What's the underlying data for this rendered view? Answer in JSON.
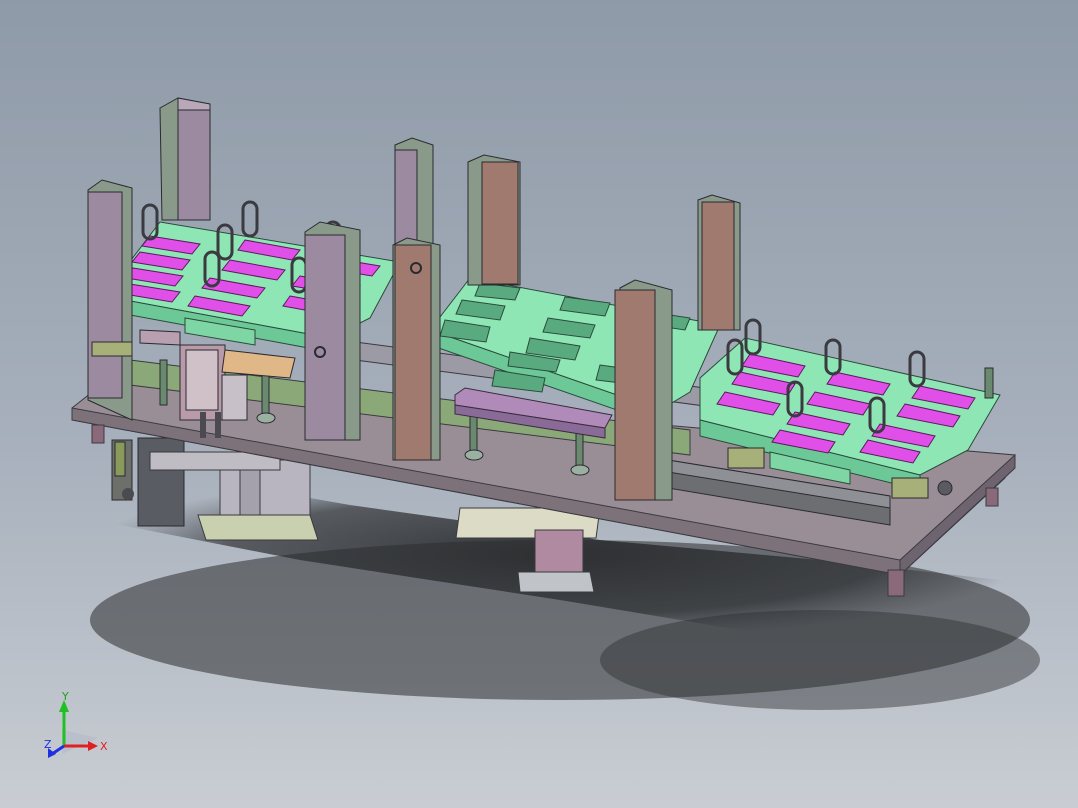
{
  "viewport": {
    "title": ""
  },
  "colors": {
    "background_top": "#8f9aa8",
    "background_bottom": "#c9cdd3",
    "base_plate": "#9a8e96",
    "tray_green": "#8ee6b4",
    "slot_magenta": "#e050e8",
    "post_brown": "#a07a6e",
    "post_gray": "#9c8aa0",
    "rail_green": "#8aa878",
    "shadow": "#2c2e30"
  },
  "triad": {
    "x_label": "X",
    "y_label": "Y",
    "z_label": "Z",
    "x_color": "#e02020",
    "y_color": "#20c020",
    "z_color": "#2030e0"
  }
}
